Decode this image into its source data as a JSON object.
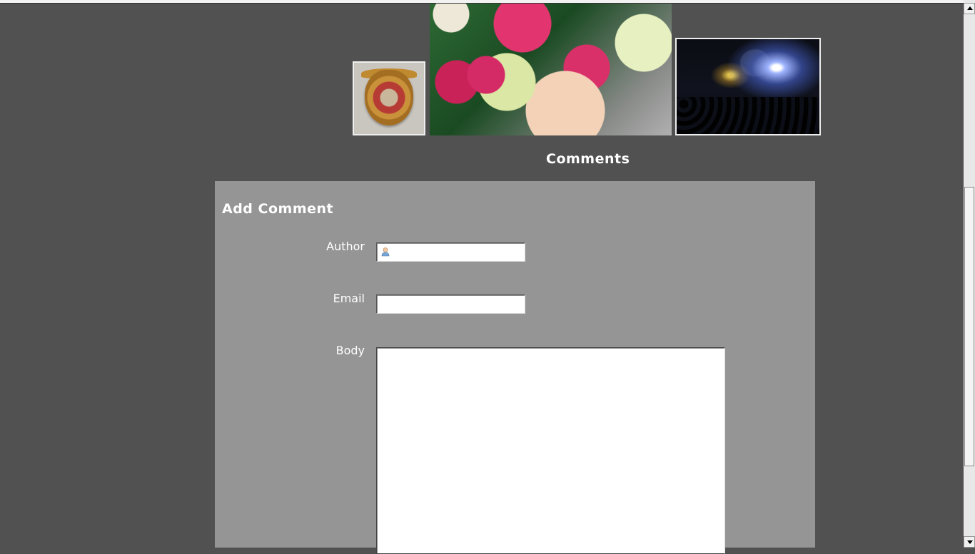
{
  "gallery": {
    "thumbnails": [
      {
        "name": "badge-photo"
      },
      {
        "name": "roses-photo"
      },
      {
        "name": "concert-photo"
      }
    ]
  },
  "comments": {
    "heading": "Comments"
  },
  "form": {
    "title": "Add Comment",
    "author_label": "Author",
    "author_value": "",
    "author_icon": "user-icon",
    "email_label": "Email",
    "email_value": "",
    "body_label": "Body",
    "body_value": ""
  },
  "colors": {
    "page_background": "#515151",
    "panel_background": "#959595",
    "text": "#ffffff"
  }
}
